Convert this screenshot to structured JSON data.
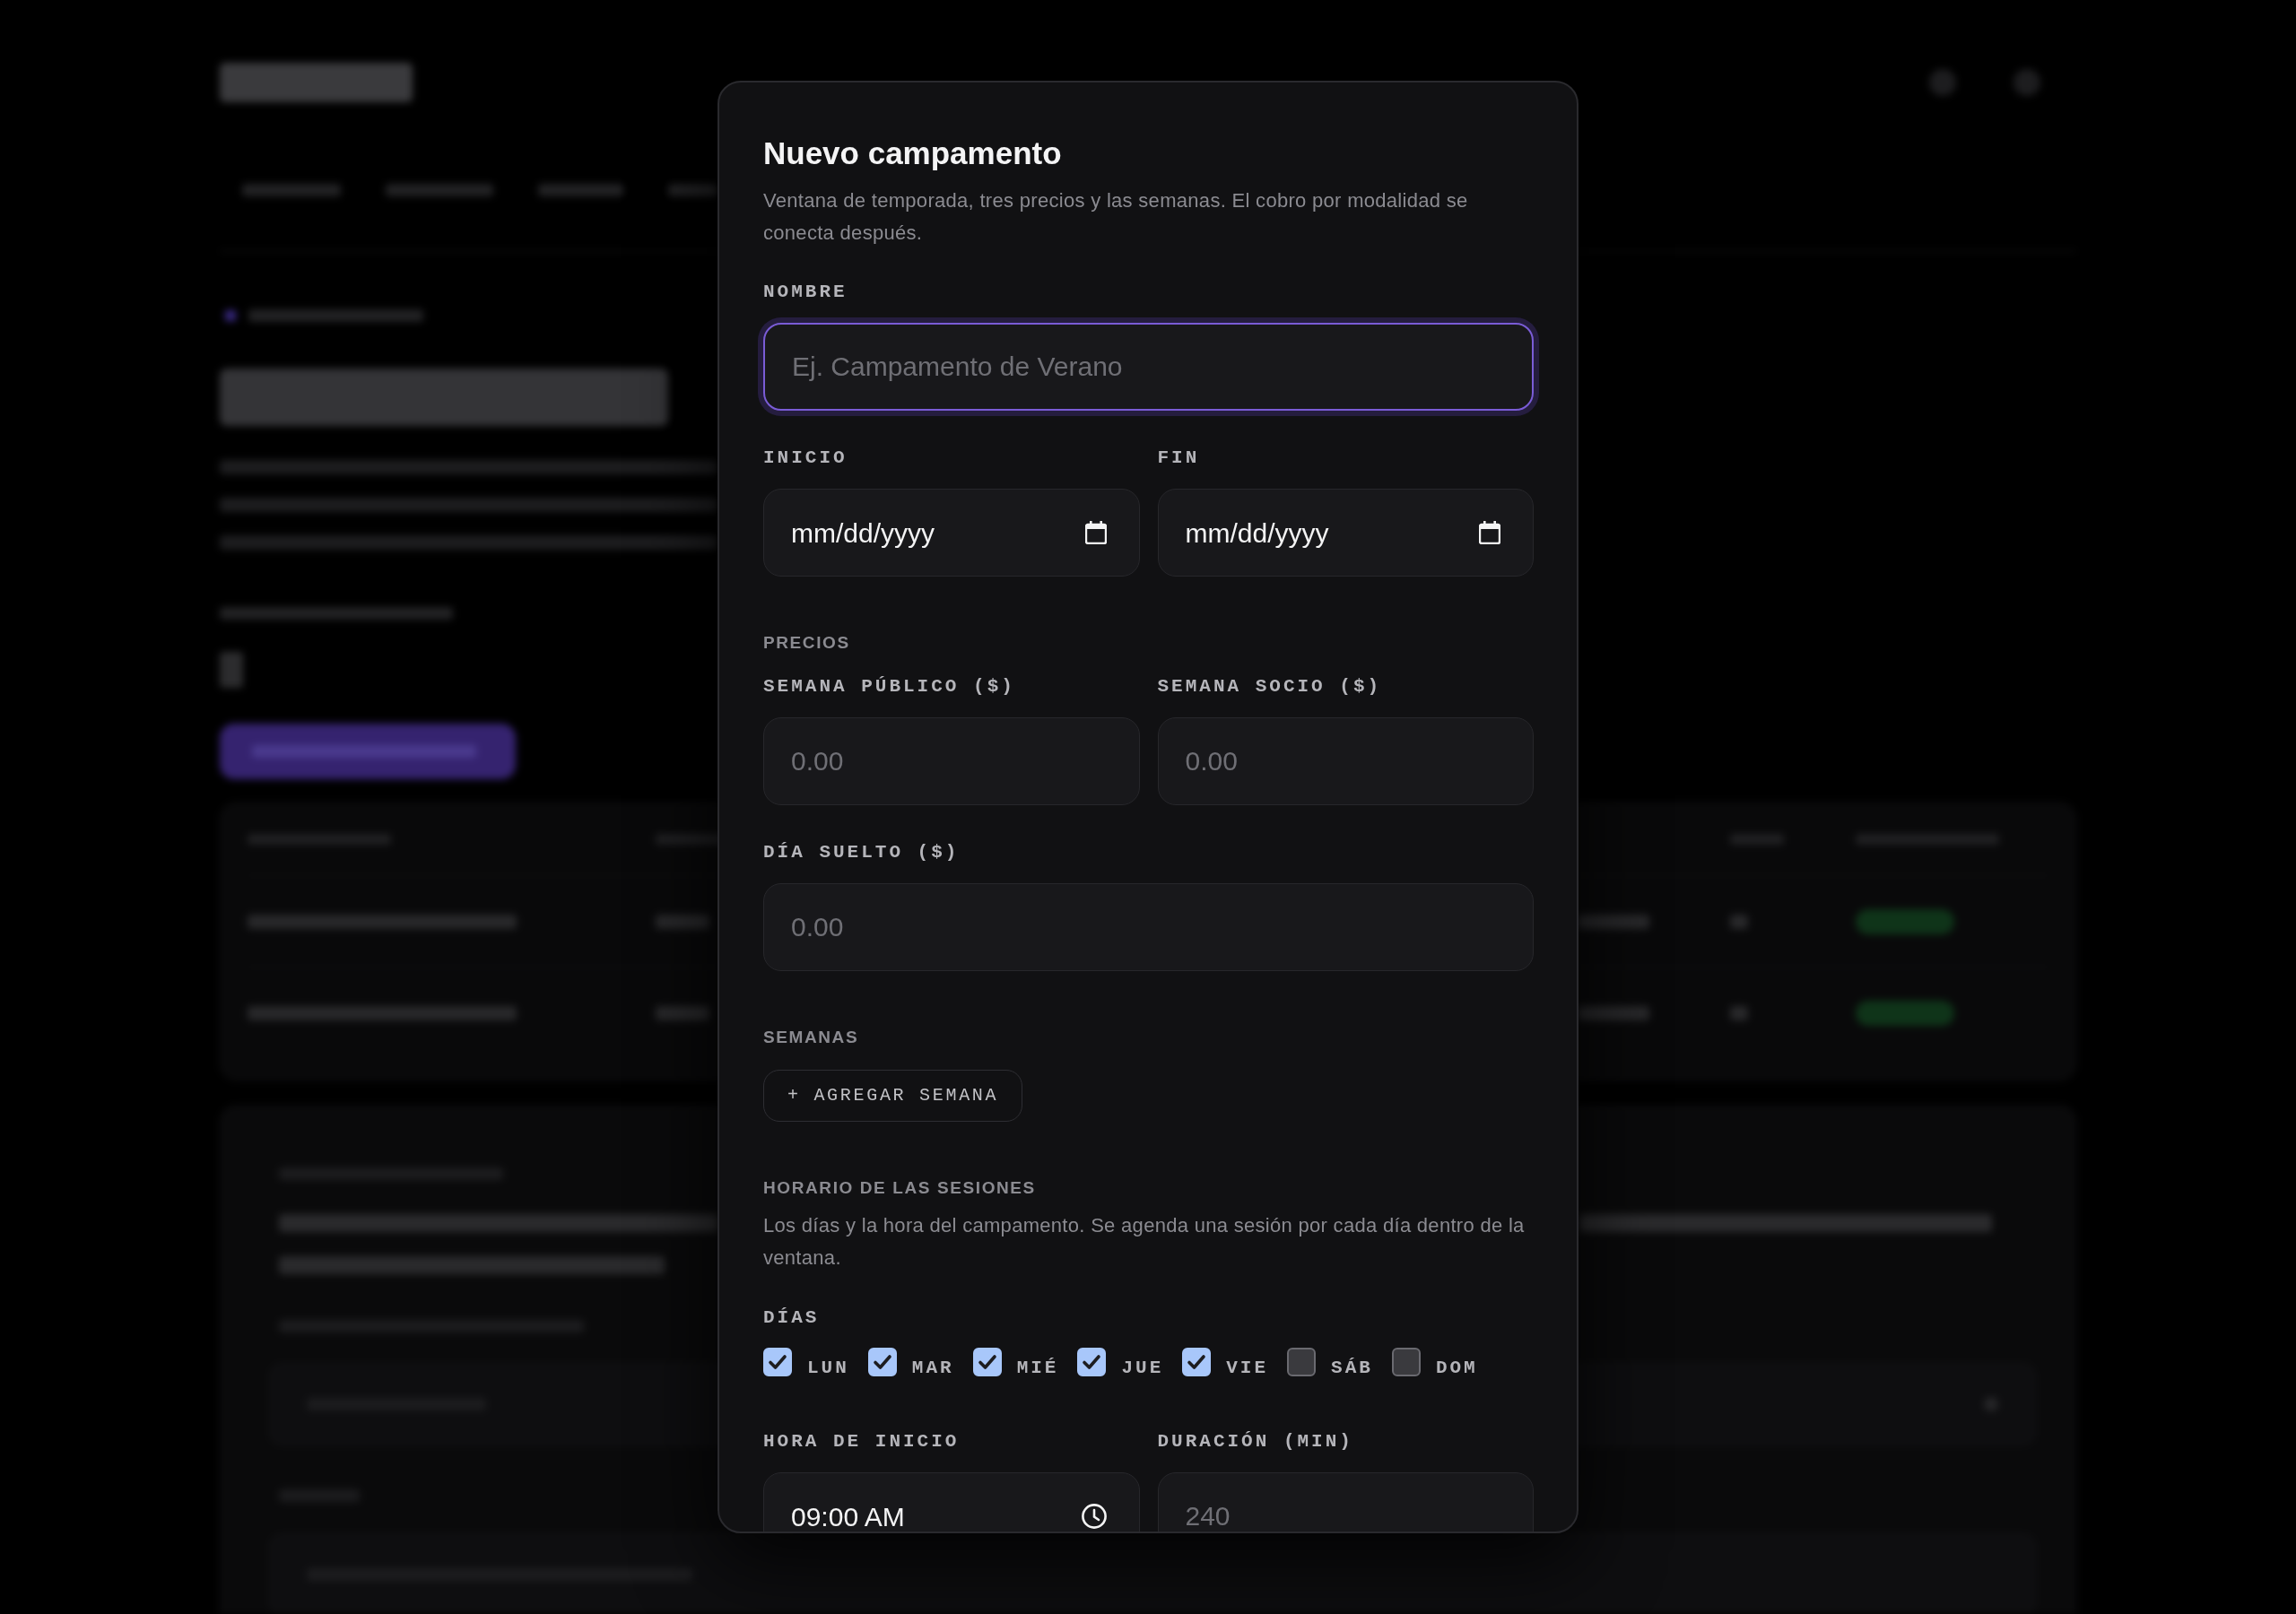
{
  "dialog": {
    "title": "Nuevo campamento",
    "subtitle": "Ventana de temporada, tres precios y las semanas. El cobro por modalidad se conecta después.",
    "sections": [
      {
        "rows": [
          [
            {
              "kind": "text",
              "label": "NOMBRE",
              "placeholder": "Ej. Campamento de Verano",
              "focused": true
            }
          ],
          [
            {
              "kind": "date",
              "label": "INICIO",
              "value": "mm/dd/yyyy",
              "focused": false
            },
            {
              "kind": "date",
              "label": "FIN",
              "value": "mm/dd/yyyy",
              "focused": false
            }
          ]
        ]
      },
      {
        "heading": "PRECIOS",
        "rows": [
          [
            {
              "kind": "text",
              "label": "SEMANA PÚBLICO ($)",
              "placeholder": "0.00",
              "focused": false
            },
            {
              "kind": "text",
              "label": "SEMANA SOCIO ($)",
              "placeholder": "0.00",
              "focused": false
            }
          ],
          [
            {
              "kind": "text",
              "label": "DÍA SUELTO ($)",
              "placeholder": "0.00",
              "focused": false
            }
          ]
        ]
      },
      {
        "heading": "SEMANAS",
        "button": "+ AGREGAR SEMANA"
      },
      {
        "heading": "HORARIO DE LAS SESIONES",
        "description": "Los días y la hora del campamento. Se agenda una sesión por cada día dentro de la ventana.",
        "days": {
          "label": "DÍAS",
          "items": [
            {
              "label": "LUN",
              "checked": true
            },
            {
              "label": "MAR",
              "checked": true
            },
            {
              "label": "MIÉ",
              "checked": true
            },
            {
              "label": "JUE",
              "checked": true
            },
            {
              "label": "VIE",
              "checked": true
            },
            {
              "label": "SÁB",
              "checked": false
            },
            {
              "label": "DOM",
              "checked": false
            }
          ]
        },
        "rows": [
          [
            {
              "kind": "time",
              "label": "HORA DE INICIO",
              "value": "09:00 AM",
              "focused": false
            },
            {
              "kind": "text",
              "label": "DURACIÓN (MIN)",
              "placeholder": "240",
              "focused": false
            }
          ]
        ]
      }
    ]
  }
}
